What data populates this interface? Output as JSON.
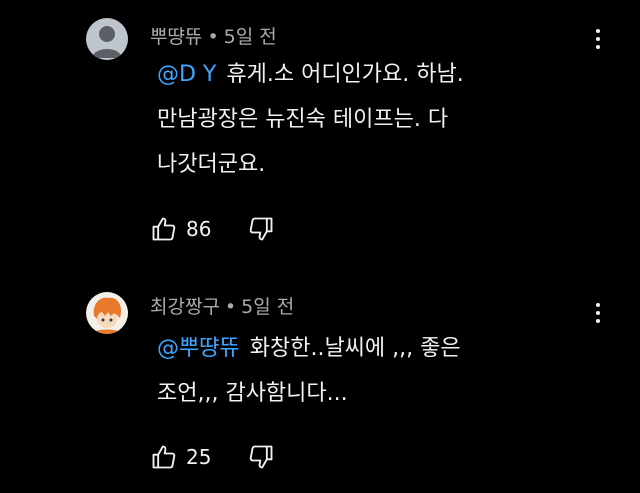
{
  "comments": [
    {
      "author": "뿌땽뜌",
      "separator": "•",
      "time": "5일 전",
      "mention": "@D Y",
      "lines": [
        "휴게.소 어디인가요. 하남.",
        "만남광장은 뉴진숙 테이프는. 다",
        "나갓더군요."
      ],
      "likes": "86",
      "avatar_icon": "default-person-avatar"
    },
    {
      "author": "최강짱구",
      "separator": "•",
      "time": "5일 전",
      "mention": "@뿌땽뜌",
      "lines": [
        "화창한..날씨에 ,,, 좋은",
        "조언,,, 감사함니다..."
      ],
      "likes": "25",
      "avatar_icon": "character-avatar"
    }
  ],
  "colors": {
    "background": "#000000",
    "text": "#f1f1f1",
    "meta": "#aaaaaa",
    "mention": "#3ea6ff"
  }
}
